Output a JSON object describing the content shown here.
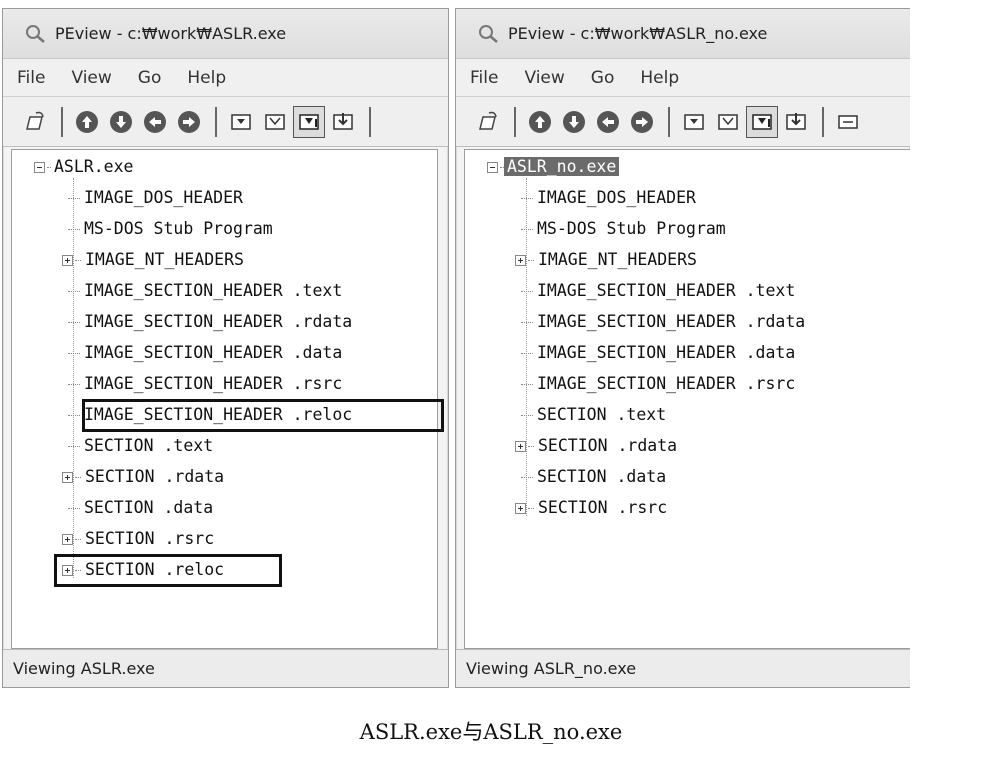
{
  "left": {
    "title": "PEview - c:₩work₩ASLR.exe",
    "menu": [
      "File",
      "View",
      "Go",
      "Help"
    ],
    "root": "ASLR.exe",
    "items": [
      "IMAGE_DOS_HEADER",
      "MS-DOS Stub Program",
      "IMAGE_NT_HEADERS",
      "IMAGE_SECTION_HEADER .text",
      "IMAGE_SECTION_HEADER .rdata",
      "IMAGE_SECTION_HEADER .data",
      "IMAGE_SECTION_HEADER .rsrc",
      "IMAGE_SECTION_HEADER .reloc",
      "SECTION .text",
      "SECTION .rdata",
      "SECTION .data",
      "SECTION .rsrc",
      "SECTION .reloc"
    ],
    "status": "Viewing ASLR.exe"
  },
  "right": {
    "title": "PEview - c:₩work₩ASLR_no.exe",
    "menu": [
      "File",
      "View",
      "Go",
      "Help"
    ],
    "root": "ASLR_no.exe",
    "items": [
      "IMAGE_DOS_HEADER",
      "MS-DOS Stub Program",
      "IMAGE_NT_HEADERS",
      "IMAGE_SECTION_HEADER .text",
      "IMAGE_SECTION_HEADER .rdata",
      "IMAGE_SECTION_HEADER .data",
      "IMAGE_SECTION_HEADER .rsrc",
      "SECTION .text",
      "SECTION .rdata",
      "SECTION .data",
      "SECTION .rsrc"
    ],
    "status": "Viewing ASLR_no.exe"
  },
  "toolbar_icons": [
    "open-file-icon",
    "nav-up-icon",
    "nav-down-icon",
    "nav-back-icon",
    "nav-forward-icon",
    "view-byte-icon",
    "view-word-icon",
    "view-dword-icon",
    "view-address-icon"
  ],
  "caption": "ASLR.exe与ASLR_no.exe",
  "colors": {
    "selection": "#6b6b6b",
    "highlight_border": "#111111"
  }
}
